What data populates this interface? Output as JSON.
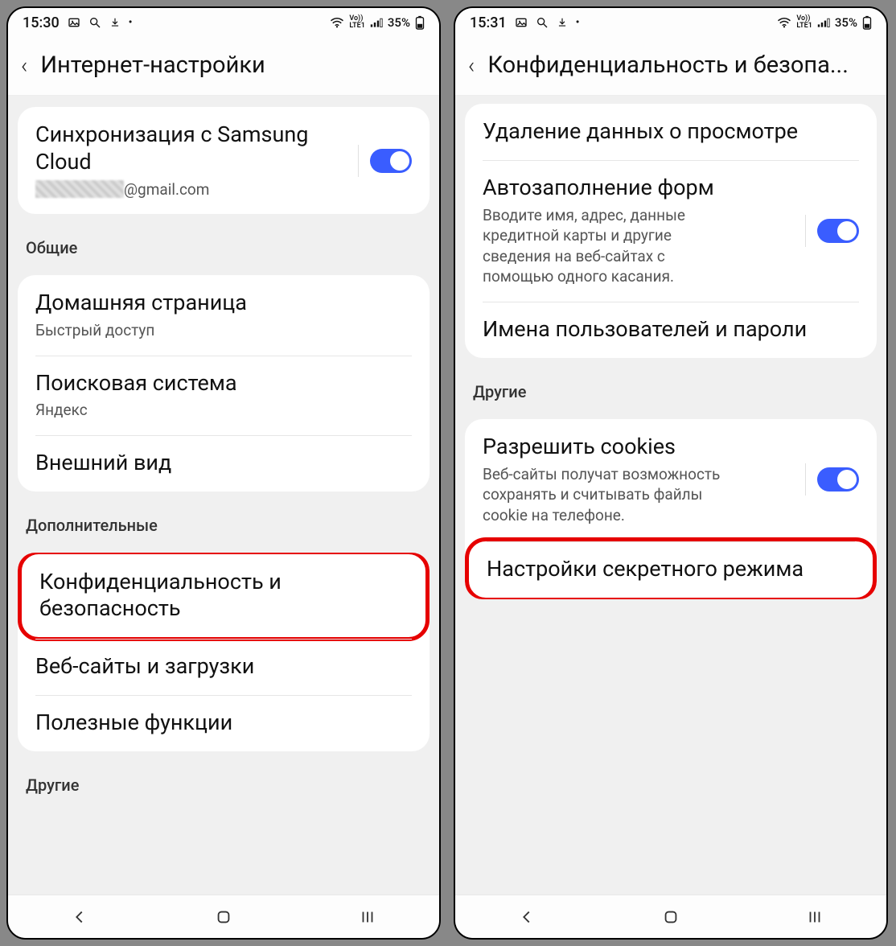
{
  "left": {
    "status": {
      "time": "15:30",
      "battery": "35%"
    },
    "header": {
      "title": "Интернет-настройки"
    },
    "sync": {
      "title": "Синхронизация с Samsung Cloud",
      "email_suffix": "@gmail.com"
    },
    "sections": {
      "general_label": "Общие",
      "homepage": {
        "title": "Домашняя страница",
        "sub": "Быстрый доступ"
      },
      "search": {
        "title": "Поисковая система",
        "sub": "Яндекс"
      },
      "appearance": {
        "title": "Внешний вид"
      },
      "advanced_label": "Дополнительные",
      "privacy": {
        "title": "Конфиденциальность и безопасность"
      },
      "sites": {
        "title": "Веб-сайты и загрузки"
      },
      "useful": {
        "title": "Полезные функции"
      },
      "other_label": "Другие"
    }
  },
  "right": {
    "status": {
      "time": "15:31",
      "battery": "35%"
    },
    "header": {
      "title": "Конфиденциальность и безопа..."
    },
    "rows": {
      "delete": {
        "title": "Удаление данных о просмотре"
      },
      "autofill": {
        "title": "Автозаполнение форм",
        "sub": "Вводите имя, адрес, данные кредитной карты и другие сведения на веб-сайтах с помощью одного касания."
      },
      "passwords": {
        "title": "Имена пользователей и пароли"
      },
      "other_label": "Другие",
      "cookies": {
        "title": "Разрешить cookies",
        "sub": "Веб-сайты получат возможность сохранять и считывать файлы cookie на телефоне."
      },
      "secret": {
        "title": "Настройки секретного режима"
      }
    }
  },
  "status_icons": {
    "lte": "LTE1"
  }
}
